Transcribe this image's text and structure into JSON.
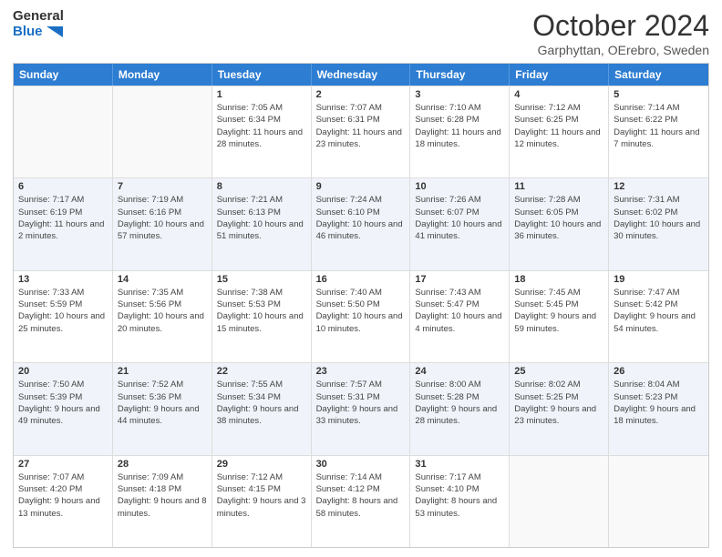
{
  "logo": {
    "line1": "General",
    "line2": "Blue"
  },
  "title": "October 2024",
  "subtitle": "Garphyttan, OErebro, Sweden",
  "days": [
    "Sunday",
    "Monday",
    "Tuesday",
    "Wednesday",
    "Thursday",
    "Friday",
    "Saturday"
  ],
  "weeks": [
    [
      {
        "day": "",
        "info": ""
      },
      {
        "day": "",
        "info": ""
      },
      {
        "day": "1",
        "info": "Sunrise: 7:05 AM\nSunset: 6:34 PM\nDaylight: 11 hours and 28 minutes."
      },
      {
        "day": "2",
        "info": "Sunrise: 7:07 AM\nSunset: 6:31 PM\nDaylight: 11 hours and 23 minutes."
      },
      {
        "day": "3",
        "info": "Sunrise: 7:10 AM\nSunset: 6:28 PM\nDaylight: 11 hours and 18 minutes."
      },
      {
        "day": "4",
        "info": "Sunrise: 7:12 AM\nSunset: 6:25 PM\nDaylight: 11 hours and 12 minutes."
      },
      {
        "day": "5",
        "info": "Sunrise: 7:14 AM\nSunset: 6:22 PM\nDaylight: 11 hours and 7 minutes."
      }
    ],
    [
      {
        "day": "6",
        "info": "Sunrise: 7:17 AM\nSunset: 6:19 PM\nDaylight: 11 hours and 2 minutes."
      },
      {
        "day": "7",
        "info": "Sunrise: 7:19 AM\nSunset: 6:16 PM\nDaylight: 10 hours and 57 minutes."
      },
      {
        "day": "8",
        "info": "Sunrise: 7:21 AM\nSunset: 6:13 PM\nDaylight: 10 hours and 51 minutes."
      },
      {
        "day": "9",
        "info": "Sunrise: 7:24 AM\nSunset: 6:10 PM\nDaylight: 10 hours and 46 minutes."
      },
      {
        "day": "10",
        "info": "Sunrise: 7:26 AM\nSunset: 6:07 PM\nDaylight: 10 hours and 41 minutes."
      },
      {
        "day": "11",
        "info": "Sunrise: 7:28 AM\nSunset: 6:05 PM\nDaylight: 10 hours and 36 minutes."
      },
      {
        "day": "12",
        "info": "Sunrise: 7:31 AM\nSunset: 6:02 PM\nDaylight: 10 hours and 30 minutes."
      }
    ],
    [
      {
        "day": "13",
        "info": "Sunrise: 7:33 AM\nSunset: 5:59 PM\nDaylight: 10 hours and 25 minutes."
      },
      {
        "day": "14",
        "info": "Sunrise: 7:35 AM\nSunset: 5:56 PM\nDaylight: 10 hours and 20 minutes."
      },
      {
        "day": "15",
        "info": "Sunrise: 7:38 AM\nSunset: 5:53 PM\nDaylight: 10 hours and 15 minutes."
      },
      {
        "day": "16",
        "info": "Sunrise: 7:40 AM\nSunset: 5:50 PM\nDaylight: 10 hours and 10 minutes."
      },
      {
        "day": "17",
        "info": "Sunrise: 7:43 AM\nSunset: 5:47 PM\nDaylight: 10 hours and 4 minutes."
      },
      {
        "day": "18",
        "info": "Sunrise: 7:45 AM\nSunset: 5:45 PM\nDaylight: 9 hours and 59 minutes."
      },
      {
        "day": "19",
        "info": "Sunrise: 7:47 AM\nSunset: 5:42 PM\nDaylight: 9 hours and 54 minutes."
      }
    ],
    [
      {
        "day": "20",
        "info": "Sunrise: 7:50 AM\nSunset: 5:39 PM\nDaylight: 9 hours and 49 minutes."
      },
      {
        "day": "21",
        "info": "Sunrise: 7:52 AM\nSunset: 5:36 PM\nDaylight: 9 hours and 44 minutes."
      },
      {
        "day": "22",
        "info": "Sunrise: 7:55 AM\nSunset: 5:34 PM\nDaylight: 9 hours and 38 minutes."
      },
      {
        "day": "23",
        "info": "Sunrise: 7:57 AM\nSunset: 5:31 PM\nDaylight: 9 hours and 33 minutes."
      },
      {
        "day": "24",
        "info": "Sunrise: 8:00 AM\nSunset: 5:28 PM\nDaylight: 9 hours and 28 minutes."
      },
      {
        "day": "25",
        "info": "Sunrise: 8:02 AM\nSunset: 5:25 PM\nDaylight: 9 hours and 23 minutes."
      },
      {
        "day": "26",
        "info": "Sunrise: 8:04 AM\nSunset: 5:23 PM\nDaylight: 9 hours and 18 minutes."
      }
    ],
    [
      {
        "day": "27",
        "info": "Sunrise: 7:07 AM\nSunset: 4:20 PM\nDaylight: 9 hours and 13 minutes."
      },
      {
        "day": "28",
        "info": "Sunrise: 7:09 AM\nSunset: 4:18 PM\nDaylight: 9 hours and 8 minutes."
      },
      {
        "day": "29",
        "info": "Sunrise: 7:12 AM\nSunset: 4:15 PM\nDaylight: 9 hours and 3 minutes."
      },
      {
        "day": "30",
        "info": "Sunrise: 7:14 AM\nSunset: 4:12 PM\nDaylight: 8 hours and 58 minutes."
      },
      {
        "day": "31",
        "info": "Sunrise: 7:17 AM\nSunset: 4:10 PM\nDaylight: 8 hours and 53 minutes."
      },
      {
        "day": "",
        "info": ""
      },
      {
        "day": "",
        "info": ""
      }
    ]
  ]
}
